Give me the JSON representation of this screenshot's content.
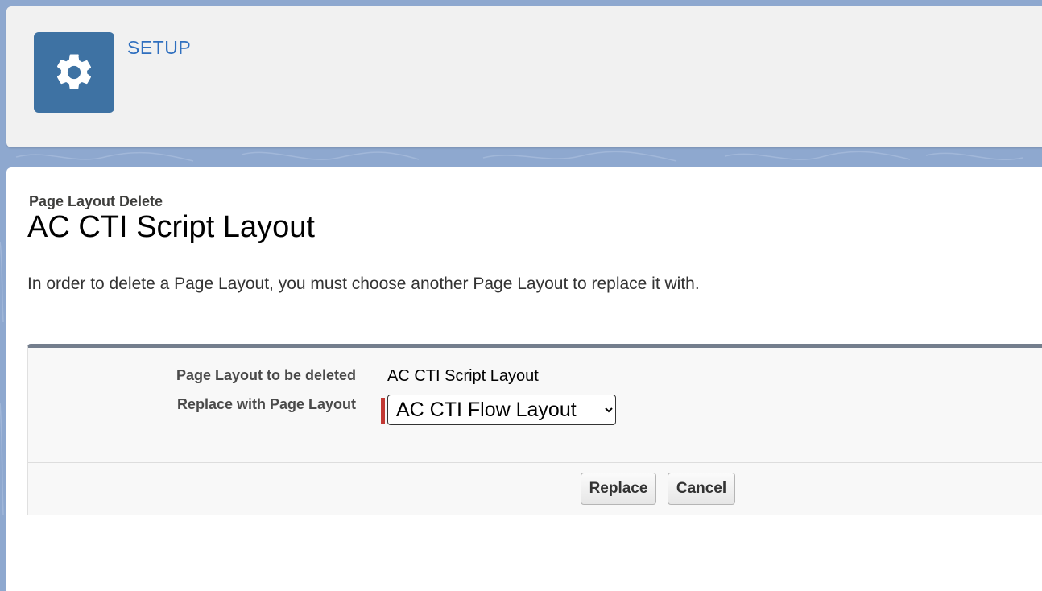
{
  "header": {
    "icon": "gear-icon",
    "title": "SETUP"
  },
  "page": {
    "type_label": "Page Layout Delete",
    "title": "AC CTI Script Layout",
    "instructions": "In order to delete a Page Layout, you must choose another Page Layout to replace it with."
  },
  "form": {
    "deleted_label": "Page Layout to be deleted",
    "deleted_value": "AC CTI Script Layout",
    "replace_label": "Replace with Page Layout",
    "replace_selected": "AC CTI Flow Layout"
  },
  "buttons": {
    "replace_label": "Replace",
    "cancel_label": "Cancel"
  },
  "colors": {
    "accent": "#3e72a3",
    "link": "#2f6fbf",
    "required": "#c23934",
    "background": "#8ea8cf"
  }
}
